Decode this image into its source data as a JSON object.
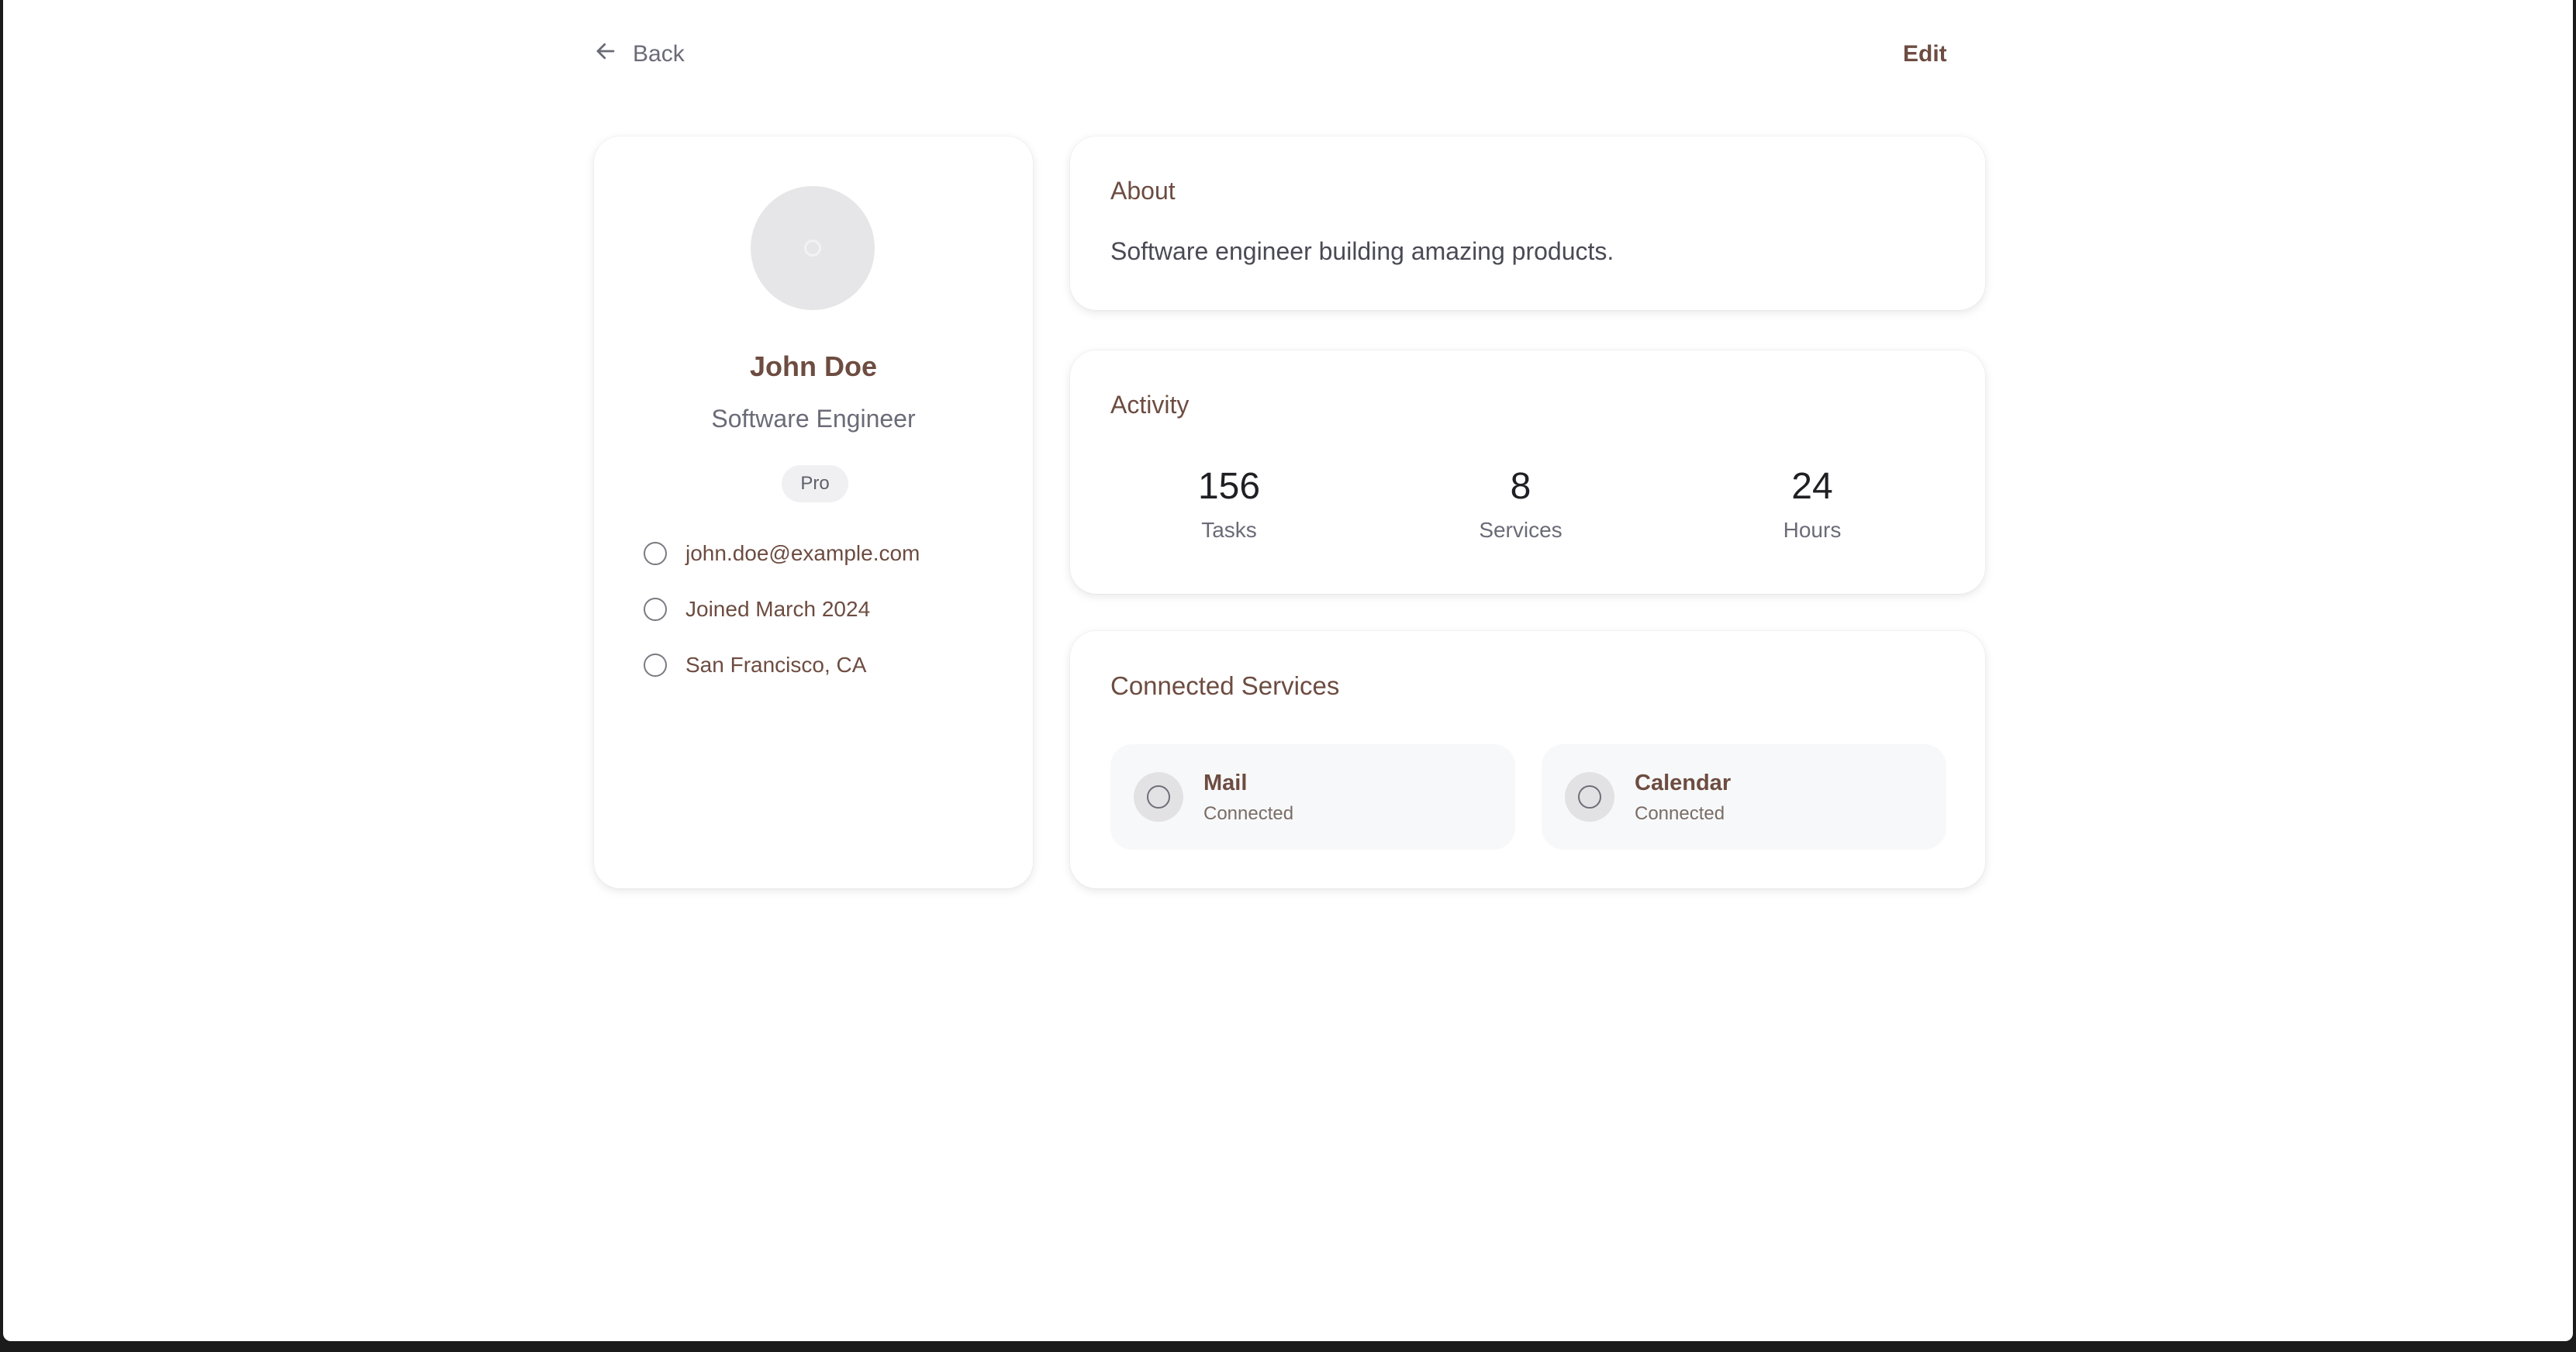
{
  "header": {
    "back_label": "Back",
    "edit_label": "Edit"
  },
  "profile": {
    "name": "John Doe",
    "role": "Software Engineer",
    "plan_badge": "Pro",
    "email": "john.doe@example.com",
    "joined": "Joined March 2024",
    "location": "San Francisco, CA"
  },
  "about": {
    "title": "About",
    "text": "Software engineer building amazing products."
  },
  "activity": {
    "title": "Activity",
    "stats": [
      {
        "value": "156",
        "label": "Tasks"
      },
      {
        "value": "8",
        "label": "Services"
      },
      {
        "value": "24",
        "label": "Hours"
      }
    ]
  },
  "services": {
    "title": "Connected Services",
    "items": [
      {
        "name": "Mail",
        "status": "Connected",
        "icon": "circle-icon"
      },
      {
        "name": "Calendar",
        "status": "Connected",
        "icon": "circle-icon"
      }
    ]
  },
  "colors": {
    "accent": "#6d4c41",
    "muted_text": "#6b6b78",
    "card_background": "#ffffff",
    "tile_background": "#f7f8f9",
    "avatar_background": "#e6e6e8"
  }
}
